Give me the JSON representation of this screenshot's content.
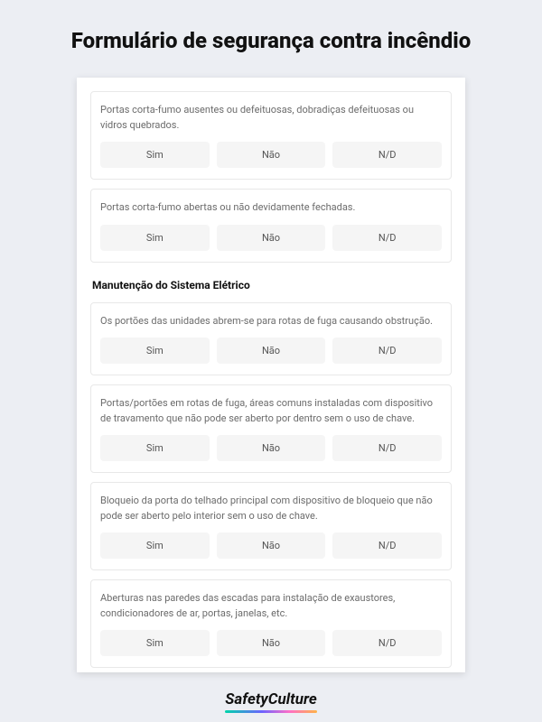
{
  "title": "Formulário de segurança contra incêndio",
  "options": {
    "yes": "Sim",
    "no": "Não",
    "na": "N/D"
  },
  "questions": {
    "q1": "Portas corta-fumo ausentes ou defeituosas, dobradiças defeituosas ou vidros quebrados.",
    "q2": "Portas corta-fumo abertas ou não devidamente fechadas.",
    "q3": "Os portões das unidades abrem-se para rotas de fuga causando obstrução.",
    "q4": "Portas/portões em rotas de fuga, áreas comuns instaladas com dispositivo de travamento que não pode ser aberto por dentro sem o uso de chave.",
    "q5": "Bloqueio da porta do telhado principal com dispositivo de bloqueio que não pode ser aberto pelo interior sem o uso de chave.",
    "q6": "Aberturas nas paredes das escadas para instalação de exaustores, condicionadores de ar, portas, janelas, etc."
  },
  "section_header": "Manutenção do Sistema Elétrico",
  "logo": "SafetyCulture"
}
